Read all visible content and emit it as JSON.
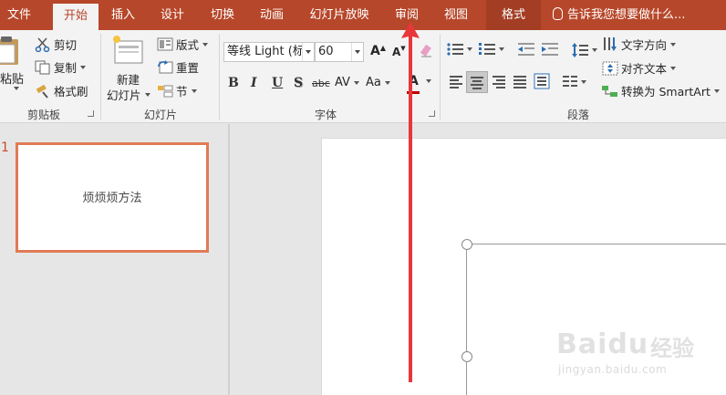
{
  "tabs": {
    "file": "文件",
    "home": "开始",
    "insert": "插入",
    "design": "设计",
    "transitions": "切换",
    "animations": "动画",
    "slideshow": "幻灯片放映",
    "review": "审阅",
    "view": "视图",
    "format": "格式"
  },
  "tell_me": "告诉我您想要做什么...",
  "clipboard": {
    "paste_label": "粘贴",
    "cut_label": "剪切",
    "copy_label": "复制",
    "format_painter_label": "格式刷",
    "group_label": "剪贴板"
  },
  "slides_group": {
    "new_slide_line1": "新建",
    "new_slide_line2": "幻灯片",
    "layout_label": "版式",
    "reset_label": "重置",
    "section_label": "节",
    "group_label": "幻灯片"
  },
  "font_group": {
    "font_name": "等线 Light (标",
    "font_size": "60",
    "bold": "B",
    "italic": "I",
    "underline": "U",
    "shadow": "S",
    "strikethrough": "abc",
    "spacing": "AV",
    "change_case": "Aa",
    "font_color": "A",
    "grow": "A",
    "shrink": "A",
    "group_label": "字体"
  },
  "paragraph_group": {
    "text_direction_label": "文字方向",
    "align_text_label": "对齐文本",
    "smartart_label": "转换为 SmartArt",
    "group_label": "段落"
  },
  "thumbnail": {
    "number": "1",
    "text": "烦烦烦方法"
  },
  "watermark": {
    "logo": "Baidu",
    "cn": "经验",
    "url": "jingyan.baidu.com"
  },
  "colors": {
    "accent": "#b7472a",
    "thumb_border": "#e07b55",
    "arrow": "#e8373a"
  }
}
